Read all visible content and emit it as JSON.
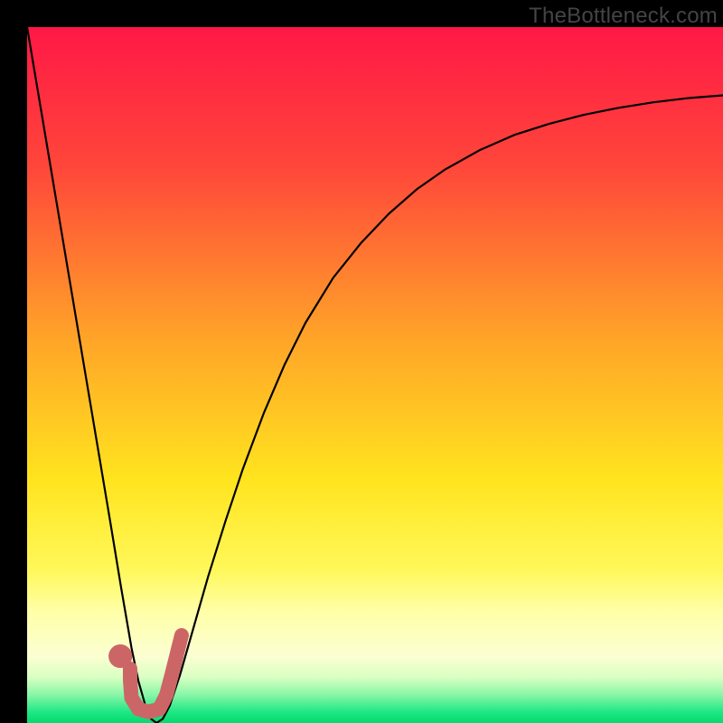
{
  "watermark": "TheBottleneck.com",
  "chart_data": {
    "type": "line",
    "title": "",
    "xlabel": "",
    "ylabel": "",
    "xlim": [
      0,
      100
    ],
    "ylim": [
      0,
      100
    ],
    "background_gradient": {
      "stops": [
        {
          "offset": 0.0,
          "color": "#ff1846"
        },
        {
          "offset": 0.2,
          "color": "#ff463a"
        },
        {
          "offset": 0.45,
          "color": "#ffa528"
        },
        {
          "offset": 0.65,
          "color": "#ffe41e"
        },
        {
          "offset": 0.78,
          "color": "#fff85a"
        },
        {
          "offset": 0.84,
          "color": "#ffffa8"
        },
        {
          "offset": 0.905,
          "color": "#fbffd2"
        },
        {
          "offset": 0.935,
          "color": "#d8ffc2"
        },
        {
          "offset": 0.96,
          "color": "#86f6a6"
        },
        {
          "offset": 0.985,
          "color": "#1be783"
        },
        {
          "offset": 1.0,
          "color": "#06d96f"
        }
      ]
    },
    "series": [
      {
        "name": "bottleneck-curve",
        "stroke": "#000000",
        "stroke_width": 2.2,
        "points": [
          [
            0.0,
            100.0
          ],
          [
            2.0,
            88.1
          ],
          [
            4.0,
            76.2
          ],
          [
            6.0,
            64.3
          ],
          [
            8.0,
            52.4
          ],
          [
            10.0,
            40.5
          ],
          [
            12.0,
            28.6
          ],
          [
            13.5,
            19.5
          ],
          [
            15.0,
            10.8
          ],
          [
            16.0,
            6.0
          ],
          [
            17.0,
            2.5
          ],
          [
            17.8,
            0.6
          ],
          [
            18.6,
            0.0
          ],
          [
            19.5,
            0.6
          ],
          [
            20.5,
            2.5
          ],
          [
            22.0,
            7.0
          ],
          [
            24.0,
            14.0
          ],
          [
            26.0,
            21.0
          ],
          [
            28.5,
            29.0
          ],
          [
            31.0,
            36.5
          ],
          [
            34.0,
            44.5
          ],
          [
            37.0,
            51.5
          ],
          [
            40.0,
            57.5
          ],
          [
            44.0,
            64.0
          ],
          [
            48.0,
            69.0
          ],
          [
            52.0,
            73.2
          ],
          [
            56.0,
            76.7
          ],
          [
            60.0,
            79.5
          ],
          [
            65.0,
            82.3
          ],
          [
            70.0,
            84.5
          ],
          [
            75.0,
            86.1
          ],
          [
            80.0,
            87.4
          ],
          [
            85.0,
            88.4
          ],
          [
            90.0,
            89.2
          ],
          [
            95.0,
            89.8
          ],
          [
            100.0,
            90.2
          ]
        ]
      }
    ],
    "annotations": [
      {
        "name": "marker-j",
        "type": "path",
        "stroke": "#cc6666",
        "stroke_width": 16,
        "linecap": "round",
        "points": [
          [
            14.8,
            7.8
          ],
          [
            14.8,
            6.2
          ],
          [
            15.0,
            3.6
          ],
          [
            16.0,
            2.0
          ],
          [
            17.4,
            1.6
          ],
          [
            19.0,
            2.0
          ],
          [
            20.0,
            4.0
          ],
          [
            20.8,
            7.0
          ],
          [
            21.6,
            10.2
          ],
          [
            22.2,
            12.6
          ]
        ]
      },
      {
        "name": "marker-dot",
        "type": "circle",
        "fill": "#cc6666",
        "cx": 13.4,
        "cy": 9.6,
        "r": 1.7
      }
    ]
  }
}
